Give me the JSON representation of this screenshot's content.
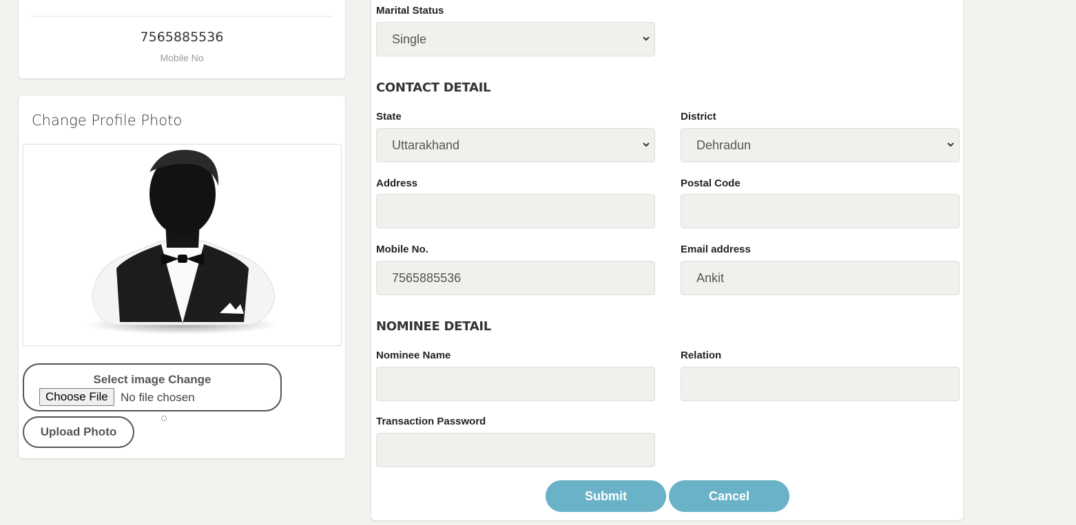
{
  "profile": {
    "mobile_value": "7565885536",
    "mobile_label": "Mobile No"
  },
  "photo": {
    "title": "Change Profile Photo",
    "select_label": "Select image Change",
    "choose_file": "Choose File",
    "no_file": "No file chosen",
    "upload_button": "Upload Photo"
  },
  "form": {
    "marital_status": {
      "label": "Marital Status",
      "value": "Single"
    },
    "contact_title": "CONTACT DETAIL",
    "state": {
      "label": "State",
      "value": "Uttarakhand"
    },
    "district": {
      "label": "District",
      "value": "Dehradun"
    },
    "address": {
      "label": "Address",
      "value": ""
    },
    "postal_code": {
      "label": "Postal Code",
      "value": ""
    },
    "mobile": {
      "label": "Mobile No.",
      "value": "7565885536"
    },
    "email": {
      "label": "Email address",
      "value": "Ankit"
    },
    "nominee_title": "NOMINEE DETAIL",
    "nominee_name": {
      "label": "Nominee Name",
      "value": ""
    },
    "relation": {
      "label": "Relation",
      "value": ""
    },
    "transaction_password": {
      "label": "Transaction Password",
      "value": ""
    },
    "submit": "Submit",
    "cancel": "Cancel"
  },
  "colors": {
    "accent": "#6ab2c7",
    "page_bg": "#f3f2ef",
    "input_bg": "#f1f0ed"
  },
  "icons": [
    "avatar-silhouette",
    "chevron-down-icon",
    "spinner-icon"
  ]
}
